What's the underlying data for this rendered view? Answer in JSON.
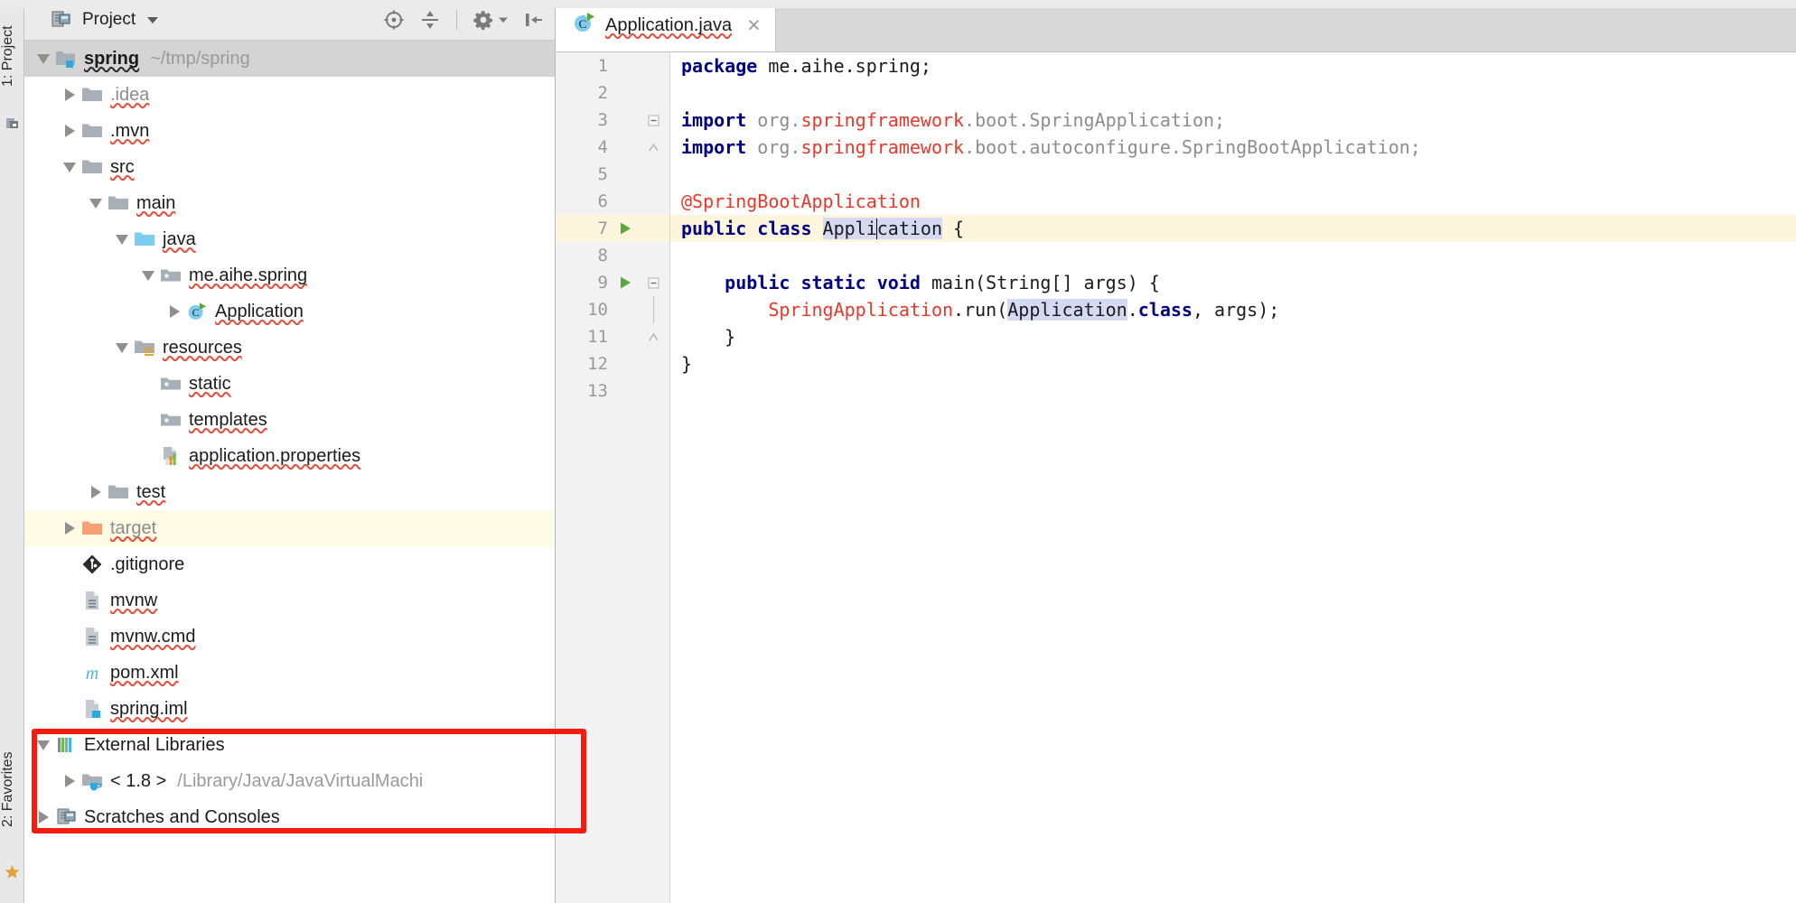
{
  "window": {
    "left_tabs": [
      {
        "label": "1: Project",
        "icon": "project-icon"
      },
      {
        "label": "2: Favorites",
        "icon": "star-icon"
      }
    ]
  },
  "project_panel": {
    "title": "Project",
    "title_icon": "project-view-icon",
    "dropdown_icon": "chevron-down-icon",
    "toolbar": [
      {
        "name": "locate-icon",
        "tooltip": "Select Opened File"
      },
      {
        "name": "collapse-all-icon",
        "tooltip": "Collapse All"
      },
      {
        "name": "gear-icon",
        "tooltip": "Settings"
      },
      {
        "name": "hide-panel-icon",
        "tooltip": "Hide"
      }
    ],
    "tree": [
      {
        "label": "spring",
        "path": "~/tmp/spring",
        "indent": 0,
        "arrow": "down",
        "icon": "module-folder-icon",
        "bold": true,
        "state": "selected-gray"
      },
      {
        "label": ".idea",
        "indent": 1,
        "arrow": "right",
        "icon": "folder-icon",
        "muted": true
      },
      {
        "label": ".mvn",
        "indent": 1,
        "arrow": "right",
        "icon": "folder-icon"
      },
      {
        "label": "src",
        "indent": 1,
        "arrow": "down",
        "icon": "folder-icon"
      },
      {
        "label": "main",
        "indent": 2,
        "arrow": "down",
        "icon": "folder-icon"
      },
      {
        "label": "java",
        "indent": 3,
        "arrow": "down",
        "icon": "source-root-icon"
      },
      {
        "label": "me.aihe.spring",
        "indent": 4,
        "arrow": "down",
        "icon": "package-icon"
      },
      {
        "label": "Application",
        "indent": 5,
        "arrow": "right",
        "icon": "java-class-runnable-icon"
      },
      {
        "label": "resources",
        "indent": 3,
        "arrow": "down",
        "icon": "resource-root-icon"
      },
      {
        "label": "static",
        "indent": 4,
        "arrow": "none",
        "icon": "package-icon"
      },
      {
        "label": "templates",
        "indent": 4,
        "arrow": "none",
        "icon": "package-icon"
      },
      {
        "label": "application.properties",
        "indent": 4,
        "arrow": "none",
        "icon": "properties-file-icon"
      },
      {
        "label": "test",
        "indent": 2,
        "arrow": "right",
        "icon": "folder-icon"
      },
      {
        "label": "target",
        "indent": 1,
        "arrow": "right",
        "icon": "excluded-folder-icon",
        "muted": true,
        "state": "selected-yellow"
      },
      {
        "label": ".gitignore",
        "indent": 1,
        "arrow": "none",
        "icon": "git-icon"
      },
      {
        "label": "mvnw",
        "indent": 1,
        "arrow": "none",
        "icon": "file-icon"
      },
      {
        "label": "mvnw.cmd",
        "indent": 1,
        "arrow": "none",
        "icon": "file-icon"
      },
      {
        "label": "pom.xml",
        "indent": 1,
        "arrow": "none",
        "icon": "maven-icon"
      },
      {
        "label": "spring.iml",
        "indent": 1,
        "arrow": "none",
        "icon": "iml-file-icon"
      },
      {
        "label": "External Libraries",
        "indent": 0,
        "arrow": "down",
        "icon": "external-libraries-icon"
      },
      {
        "label": "< 1.8 >",
        "path": "/Library/Java/JavaVirtualMachi",
        "indent": 1,
        "arrow": "right",
        "icon": "jdk-icon"
      },
      {
        "label": "Scratches and Consoles",
        "indent": 0,
        "arrow": "right",
        "icon": "scratches-icon"
      }
    ]
  },
  "annotation": {
    "color": "#f61b0e",
    "shape": "rectangle"
  },
  "editor": {
    "tab": {
      "label": "Application.java",
      "icon": "java-class-runnable-icon",
      "close_label": "×"
    },
    "lines": [
      {
        "n": "1",
        "run": false,
        "fold": "",
        "tokens": [
          {
            "t": "package ",
            "c": "kw"
          },
          {
            "t": "me.aihe.spring;",
            "c": ""
          }
        ]
      },
      {
        "n": "2",
        "run": false,
        "fold": "",
        "tokens": []
      },
      {
        "n": "3",
        "run": false,
        "fold": "start",
        "tokens": [
          {
            "t": "import ",
            "c": "kw"
          },
          {
            "t": "org.",
            "c": "gry"
          },
          {
            "t": "springframework",
            "c": "red"
          },
          {
            "t": ".boot.SpringApplication;",
            "c": "gry"
          }
        ]
      },
      {
        "n": "4",
        "run": false,
        "fold": "end",
        "tokens": [
          {
            "t": "import ",
            "c": "kw"
          },
          {
            "t": "org.",
            "c": "gry"
          },
          {
            "t": "springframework",
            "c": "red"
          },
          {
            "t": ".boot.autoconfigure.SpringBootApplication;",
            "c": "gry"
          }
        ]
      },
      {
        "n": "5",
        "run": false,
        "fold": "",
        "tokens": []
      },
      {
        "n": "6",
        "run": false,
        "fold": "",
        "tokens": [
          {
            "t": "@SpringBootApplication",
            "c": "ann"
          }
        ]
      },
      {
        "n": "7",
        "run": true,
        "fold": "",
        "current": true,
        "tokens": [
          {
            "t": "public class ",
            "c": "kw"
          },
          {
            "t": "Appli",
            "c": "sel"
          },
          {
            "t": "|",
            "c": "caret"
          },
          {
            "t": "cation",
            "c": "sel"
          },
          {
            "t": " {",
            "c": ""
          }
        ]
      },
      {
        "n": "8",
        "run": false,
        "fold": "",
        "tokens": []
      },
      {
        "n": "9",
        "run": true,
        "fold": "start",
        "tokens": [
          {
            "t": "    public static void ",
            "c": "kw"
          },
          {
            "t": "main(String[] args) {",
            "c": ""
          }
        ]
      },
      {
        "n": "10",
        "run": false,
        "fold": "bar",
        "tokens": [
          {
            "t": "        ",
            "c": ""
          },
          {
            "t": "SpringApplication",
            "c": "red"
          },
          {
            "t": ".run(",
            "c": ""
          },
          {
            "t": "Application",
            "c": "sel"
          },
          {
            "t": ".",
            "c": ""
          },
          {
            "t": "class",
            "c": "kw"
          },
          {
            "t": ", args);",
            "c": ""
          }
        ]
      },
      {
        "n": "11",
        "run": false,
        "fold": "end",
        "tokens": [
          {
            "t": "    }",
            "c": ""
          }
        ]
      },
      {
        "n": "12",
        "run": false,
        "fold": "",
        "tokens": [
          {
            "t": "}",
            "c": ""
          }
        ]
      },
      {
        "n": "13",
        "run": false,
        "fold": "",
        "tokens": []
      }
    ]
  },
  "colors": {
    "keyword": "#000082",
    "error_red": "#e8372b",
    "selection": "#d5d9f2",
    "current_line": "#fdf6dd",
    "annotation_box": "#f61b0e",
    "source_root": "#7dcdf0",
    "excluded_folder": "#f5a173"
  }
}
